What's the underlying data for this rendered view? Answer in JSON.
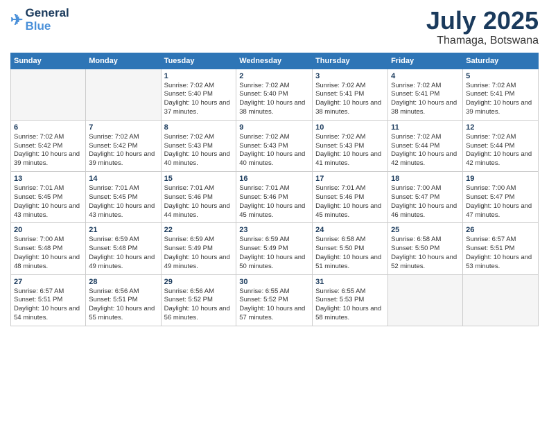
{
  "logo": {
    "line1": "General",
    "line2": "Blue"
  },
  "title": "July 2025",
  "location": "Thamaga, Botswana",
  "days_of_week": [
    "Sunday",
    "Monday",
    "Tuesday",
    "Wednesday",
    "Thursday",
    "Friday",
    "Saturday"
  ],
  "weeks": [
    [
      {
        "day": "",
        "sunrise": "",
        "sunset": "",
        "daylight": ""
      },
      {
        "day": "",
        "sunrise": "",
        "sunset": "",
        "daylight": ""
      },
      {
        "day": "1",
        "sunrise": "Sunrise: 7:02 AM",
        "sunset": "Sunset: 5:40 PM",
        "daylight": "Daylight: 10 hours and 37 minutes."
      },
      {
        "day": "2",
        "sunrise": "Sunrise: 7:02 AM",
        "sunset": "Sunset: 5:40 PM",
        "daylight": "Daylight: 10 hours and 38 minutes."
      },
      {
        "day": "3",
        "sunrise": "Sunrise: 7:02 AM",
        "sunset": "Sunset: 5:41 PM",
        "daylight": "Daylight: 10 hours and 38 minutes."
      },
      {
        "day": "4",
        "sunrise": "Sunrise: 7:02 AM",
        "sunset": "Sunset: 5:41 PM",
        "daylight": "Daylight: 10 hours and 38 minutes."
      },
      {
        "day": "5",
        "sunrise": "Sunrise: 7:02 AM",
        "sunset": "Sunset: 5:41 PM",
        "daylight": "Daylight: 10 hours and 39 minutes."
      }
    ],
    [
      {
        "day": "6",
        "sunrise": "Sunrise: 7:02 AM",
        "sunset": "Sunset: 5:42 PM",
        "daylight": "Daylight: 10 hours and 39 minutes."
      },
      {
        "day": "7",
        "sunrise": "Sunrise: 7:02 AM",
        "sunset": "Sunset: 5:42 PM",
        "daylight": "Daylight: 10 hours and 39 minutes."
      },
      {
        "day": "8",
        "sunrise": "Sunrise: 7:02 AM",
        "sunset": "Sunset: 5:43 PM",
        "daylight": "Daylight: 10 hours and 40 minutes."
      },
      {
        "day": "9",
        "sunrise": "Sunrise: 7:02 AM",
        "sunset": "Sunset: 5:43 PM",
        "daylight": "Daylight: 10 hours and 40 minutes."
      },
      {
        "day": "10",
        "sunrise": "Sunrise: 7:02 AM",
        "sunset": "Sunset: 5:43 PM",
        "daylight": "Daylight: 10 hours and 41 minutes."
      },
      {
        "day": "11",
        "sunrise": "Sunrise: 7:02 AM",
        "sunset": "Sunset: 5:44 PM",
        "daylight": "Daylight: 10 hours and 42 minutes."
      },
      {
        "day": "12",
        "sunrise": "Sunrise: 7:02 AM",
        "sunset": "Sunset: 5:44 PM",
        "daylight": "Daylight: 10 hours and 42 minutes."
      }
    ],
    [
      {
        "day": "13",
        "sunrise": "Sunrise: 7:01 AM",
        "sunset": "Sunset: 5:45 PM",
        "daylight": "Daylight: 10 hours and 43 minutes."
      },
      {
        "day": "14",
        "sunrise": "Sunrise: 7:01 AM",
        "sunset": "Sunset: 5:45 PM",
        "daylight": "Daylight: 10 hours and 43 minutes."
      },
      {
        "day": "15",
        "sunrise": "Sunrise: 7:01 AM",
        "sunset": "Sunset: 5:46 PM",
        "daylight": "Daylight: 10 hours and 44 minutes."
      },
      {
        "day": "16",
        "sunrise": "Sunrise: 7:01 AM",
        "sunset": "Sunset: 5:46 PM",
        "daylight": "Daylight: 10 hours and 45 minutes."
      },
      {
        "day": "17",
        "sunrise": "Sunrise: 7:01 AM",
        "sunset": "Sunset: 5:46 PM",
        "daylight": "Daylight: 10 hours and 45 minutes."
      },
      {
        "day": "18",
        "sunrise": "Sunrise: 7:00 AM",
        "sunset": "Sunset: 5:47 PM",
        "daylight": "Daylight: 10 hours and 46 minutes."
      },
      {
        "day": "19",
        "sunrise": "Sunrise: 7:00 AM",
        "sunset": "Sunset: 5:47 PM",
        "daylight": "Daylight: 10 hours and 47 minutes."
      }
    ],
    [
      {
        "day": "20",
        "sunrise": "Sunrise: 7:00 AM",
        "sunset": "Sunset: 5:48 PM",
        "daylight": "Daylight: 10 hours and 48 minutes."
      },
      {
        "day": "21",
        "sunrise": "Sunrise: 6:59 AM",
        "sunset": "Sunset: 5:48 PM",
        "daylight": "Daylight: 10 hours and 49 minutes."
      },
      {
        "day": "22",
        "sunrise": "Sunrise: 6:59 AM",
        "sunset": "Sunset: 5:49 PM",
        "daylight": "Daylight: 10 hours and 49 minutes."
      },
      {
        "day": "23",
        "sunrise": "Sunrise: 6:59 AM",
        "sunset": "Sunset: 5:49 PM",
        "daylight": "Daylight: 10 hours and 50 minutes."
      },
      {
        "day": "24",
        "sunrise": "Sunrise: 6:58 AM",
        "sunset": "Sunset: 5:50 PM",
        "daylight": "Daylight: 10 hours and 51 minutes."
      },
      {
        "day": "25",
        "sunrise": "Sunrise: 6:58 AM",
        "sunset": "Sunset: 5:50 PM",
        "daylight": "Daylight: 10 hours and 52 minutes."
      },
      {
        "day": "26",
        "sunrise": "Sunrise: 6:57 AM",
        "sunset": "Sunset: 5:51 PM",
        "daylight": "Daylight: 10 hours and 53 minutes."
      }
    ],
    [
      {
        "day": "27",
        "sunrise": "Sunrise: 6:57 AM",
        "sunset": "Sunset: 5:51 PM",
        "daylight": "Daylight: 10 hours and 54 minutes."
      },
      {
        "day": "28",
        "sunrise": "Sunrise: 6:56 AM",
        "sunset": "Sunset: 5:51 PM",
        "daylight": "Daylight: 10 hours and 55 minutes."
      },
      {
        "day": "29",
        "sunrise": "Sunrise: 6:56 AM",
        "sunset": "Sunset: 5:52 PM",
        "daylight": "Daylight: 10 hours and 56 minutes."
      },
      {
        "day": "30",
        "sunrise": "Sunrise: 6:55 AM",
        "sunset": "Sunset: 5:52 PM",
        "daylight": "Daylight: 10 hours and 57 minutes."
      },
      {
        "day": "31",
        "sunrise": "Sunrise: 6:55 AM",
        "sunset": "Sunset: 5:53 PM",
        "daylight": "Daylight: 10 hours and 58 minutes."
      },
      {
        "day": "",
        "sunrise": "",
        "sunset": "",
        "daylight": ""
      },
      {
        "day": "",
        "sunrise": "",
        "sunset": "",
        "daylight": ""
      }
    ]
  ]
}
